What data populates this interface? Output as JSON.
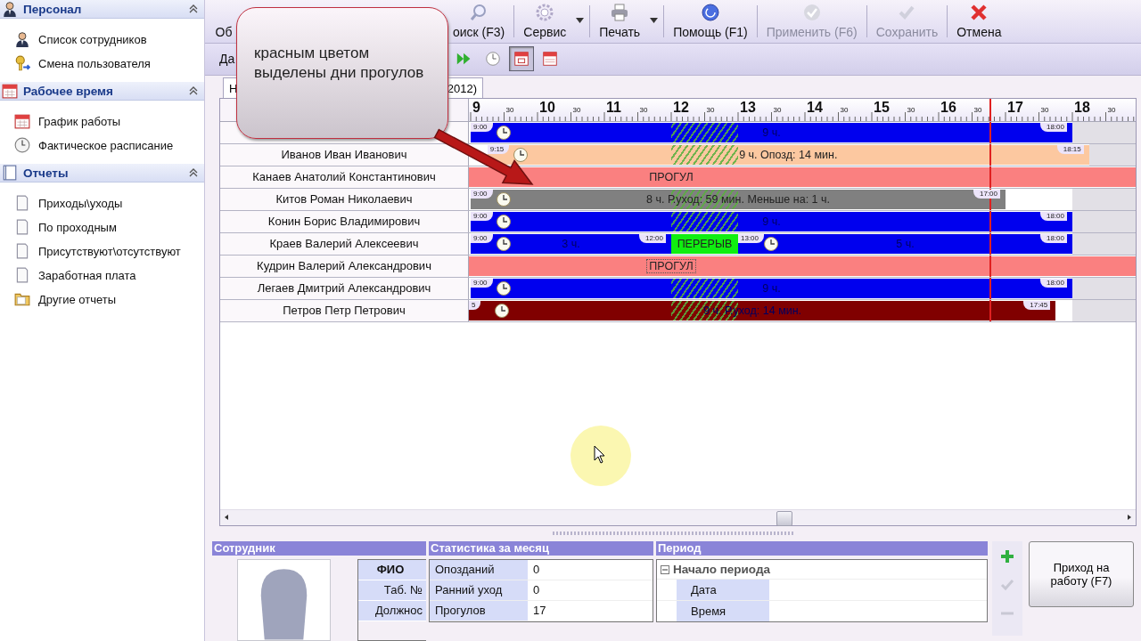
{
  "sidebar": {
    "groups": [
      {
        "title": "Персонал",
        "kind": "person",
        "expanded": true,
        "items": [
          {
            "label": "Список сотрудников",
            "kind": "person"
          },
          {
            "label": "Смена пользователя",
            "kind": "key"
          }
        ]
      },
      {
        "title": "Рабочее время",
        "kind": "calendar",
        "expanded": true,
        "items": [
          {
            "label": "График работы",
            "kind": "calendar"
          },
          {
            "label": "Фактическое расписание",
            "kind": "clock"
          }
        ]
      },
      {
        "title": "Отчеты",
        "kind": "book",
        "expanded": true,
        "items": [
          {
            "label": "Приходы\\уходы",
            "kind": "page"
          },
          {
            "label": "По проходным",
            "kind": "page"
          },
          {
            "label": "Присутствуют\\отсутствуют",
            "kind": "page"
          },
          {
            "label": "Заработная плата",
            "kind": "page"
          },
          {
            "label": "Другие отчеты",
            "kind": "folder"
          }
        ]
      }
    ]
  },
  "toolbar": {
    "buttons": [
      {
        "label": "Об",
        "kind": "none",
        "disabled": false,
        "dropdown": false
      },
      {
        "label": "оиск (F3)",
        "kind": "search",
        "disabled": false,
        "dropdown": false
      },
      {
        "label": "Сервис",
        "kind": "gear",
        "disabled": false,
        "dropdown": true
      },
      {
        "label": "Печать",
        "kind": "printer",
        "disabled": false,
        "dropdown": true
      },
      {
        "label": "Помощь (F1)",
        "kind": "help",
        "disabled": false,
        "dropdown": false
      },
      {
        "label": "Применить (F6)",
        "kind": "check-circle",
        "disabled": true,
        "dropdown": false
      },
      {
        "label": "Сохранить",
        "kind": "check",
        "disabled": true,
        "dropdown": false
      },
      {
        "label": "Отмена",
        "kind": "cross",
        "disabled": false,
        "dropdown": false
      }
    ]
  },
  "subtoolbar": {
    "label": "Да",
    "tools": [
      {
        "kind": "forward",
        "selected": false
      },
      {
        "kind": "clock",
        "selected": false
      },
      {
        "kind": "calendar",
        "selected": true
      },
      {
        "kind": "calendar-grid",
        "selected": false
      }
    ]
  },
  "tab": {
    "label_start": "Н",
    "label_end": "2012)",
    "selected": true
  },
  "callout": {
    "text": "красным цветом выделены дни прогулов"
  },
  "timeline": {
    "ticks": [
      {
        "label": "9",
        "kind": "hour"
      },
      {
        "label": "30",
        "kind": "half"
      },
      {
        "label": "10",
        "kind": "hour"
      },
      {
        "label": "30",
        "kind": "half"
      },
      {
        "label": "11",
        "kind": "hour"
      },
      {
        "label": "30",
        "kind": "half"
      },
      {
        "label": "12",
        "kind": "hour"
      },
      {
        "label": "30",
        "kind": "half"
      },
      {
        "label": "13",
        "kind": "hour"
      },
      {
        "label": "30",
        "kind": "half"
      },
      {
        "label": "14",
        "kind": "hour"
      },
      {
        "label": "30",
        "kind": "half"
      },
      {
        "label": "15",
        "kind": "hour"
      },
      {
        "label": "30",
        "kind": "half"
      },
      {
        "label": "16",
        "kind": "hour"
      },
      {
        "label": "30",
        "kind": "half"
      },
      {
        "label": "17",
        "kind": "hour"
      },
      {
        "label": "30",
        "kind": "half"
      },
      {
        "label": "18",
        "kind": "hour"
      },
      {
        "label": "30",
        "kind": "half"
      }
    ],
    "now_marker": {
      "level": 0.781
    },
    "rows": [
      {
        "segments": [
          {
            "kind": "work",
            "color": "#0000ee",
            "label": "9 ч.",
            "start_tag": "9:00",
            "end_tag": "18:00",
            "hatched": true
          }
        ]
      },
      {
        "name": "Иванов Иван Иванович",
        "segments": [
          {
            "kind": "work",
            "color": "#fcc8a0",
            "label": "9 ч.  Опозд: 14 мин.",
            "start_tag": "9:15",
            "end_tag": "18:15",
            "hatched": true
          }
        ]
      },
      {
        "name": "Канаев Анатолий Константинович",
        "segments": [
          {
            "kind": "absent",
            "color": "#fa8080",
            "label": "ПРОГУЛ",
            "focused": false
          }
        ]
      },
      {
        "name": "Китов Роман Николаевич",
        "segments": [
          {
            "kind": "work",
            "color": "#808080",
            "label": "8 ч.  Р.уход: 59 мин. Меньше на: 1 ч.",
            "start_tag": "9:00",
            "end_tag": "17:00",
            "hatched": true
          }
        ]
      },
      {
        "name": "Конин Борис Владимирович",
        "segments": [
          {
            "kind": "work",
            "color": "#0000ee",
            "label": "9 ч.",
            "start_tag": "9:00",
            "end_tag": "18:00",
            "hatched": true
          }
        ]
      },
      {
        "name": "Краев Валерий Алексеевич",
        "segments": [
          {
            "kind": "work",
            "color": "#0000ee",
            "label": "3 ч.",
            "start_tag": "9:00",
            "end_tag": "12:00"
          },
          {
            "kind": "break",
            "color": "#10ee10",
            "label": "ПЕРЕРЫВ"
          },
          {
            "kind": "work",
            "color": "#0000ee",
            "label": "5 ч.",
            "start_tag": "13:00",
            "end_tag": "18:00"
          }
        ]
      },
      {
        "name": "Кудрин Валерий Александрович",
        "segments": [
          {
            "kind": "absent",
            "color": "#fa8080",
            "label": "ПРОГУЛ",
            "focused": true
          }
        ]
      },
      {
        "name": "Легаев Дмитрий Александрович",
        "segments": [
          {
            "kind": "work",
            "color": "#0000ee",
            "label": "9 ч.",
            "start_tag": "9:00",
            "end_tag": "18:00",
            "hatched": true
          }
        ]
      },
      {
        "name": "Петров Петр Петрович",
        "segments": [
          {
            "kind": "work",
            "color": "#800000",
            "label": "9 ч.  Р.уход: 14 мин.",
            "start_tag": "5",
            "end_tag": "17:45",
            "hatched": true
          }
        ]
      }
    ]
  },
  "employee": {
    "title": "Сотрудник",
    "fields": [
      {
        "label": "ФИО",
        "bold": true
      },
      {
        "label": "Таб. №",
        "bold": false
      },
      {
        "label": "Должнос",
        "bold": false
      }
    ]
  },
  "stats": {
    "title": "Статистика за месяц",
    "rows": [
      {
        "label": "Опозданий",
        "value": "0"
      },
      {
        "label": "Ранний уход",
        "value": "0"
      },
      {
        "label": "Прогулов",
        "value": "17"
      }
    ]
  },
  "period": {
    "title": "Период",
    "group": {
      "label": "Начало периода",
      "expanded": true,
      "fields": [
        "Дата",
        "Время"
      ]
    }
  },
  "side_tools": [
    {
      "kind": "plus",
      "disabled": false
    },
    {
      "kind": "check",
      "disabled": true
    },
    {
      "kind": "minus",
      "disabled": true
    }
  ],
  "action_button": {
    "label": "Приход на работу (F7)"
  }
}
